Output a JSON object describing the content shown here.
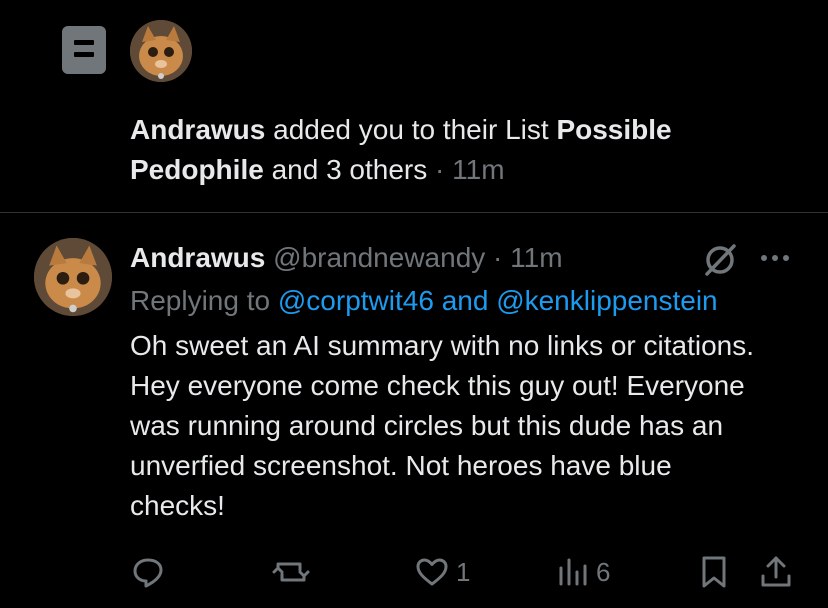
{
  "notification": {
    "actor": "Andrawus",
    "text_middle": " added you to their List ",
    "list_name": "Possible Pedophile",
    "text_tail": " and 3 others",
    "separator": " · ",
    "time": "11m"
  },
  "reply": {
    "name": "Andrawus",
    "handle": "@brandnewandy",
    "separator": " · ",
    "time": "11m",
    "replying_prefix": "Replying to ",
    "replying_targets": "@corptwit46 and @kenklippenstein",
    "body": "Oh sweet an AI summary with no links or citations. Hey everyone come check this guy out! Everyone was running around circles but this dude has an unverfied screenshot. Not heroes have blue checks!",
    "actions": {
      "reply_count": "",
      "repost_count": "",
      "like_count": "1",
      "views_count": "6"
    }
  },
  "icons": {
    "list": "list-icon",
    "grok": "grok-icon",
    "more": "more-icon",
    "reply": "reply-icon",
    "repost": "repost-icon",
    "like": "heart-icon",
    "views": "views-icon",
    "bookmark": "bookmark-icon",
    "share": "share-icon"
  },
  "colors": {
    "background": "#000000",
    "text": "#e7e9ea",
    "muted": "#71767b",
    "link": "#1d9bf0",
    "divider": "#2f3336"
  }
}
